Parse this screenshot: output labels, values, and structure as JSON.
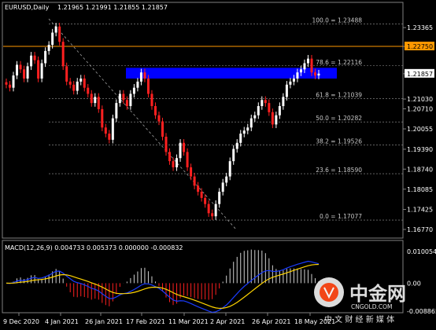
{
  "header": {
    "symbol": "EURUSD,Daily",
    "ohlc": "1.21965 1.21991 1.21855 1.21857"
  },
  "price_axis": {
    "labels": [
      "1.23365",
      "1.22750",
      "1.21857",
      "1.21030",
      "1.20710",
      "1.20055",
      "1.19390",
      "1.18740",
      "1.18085",
      "1.17425",
      "1.16770"
    ],
    "highlight_line_label": "1.22750",
    "current_price_label": "1.21857"
  },
  "date_axis": {
    "labels": [
      "9 Dec 2020",
      "4 Jan 2021",
      "26 Jan 2021",
      "17 Feb 2021",
      "11 Mar 2021",
      "2 Apr 2021",
      "26 Apr 2021",
      "18 May 2021"
    ]
  },
  "fibonacci": [
    {
      "label": "100.0 = 1.23488",
      "price": 1.23488
    },
    {
      "label": "78.6 = 1.22116",
      "price": 1.22116
    },
    {
      "label": "61.8 = 1.21039",
      "price": 1.21039
    },
    {
      "label": "50.0 = 1.20282",
      "price": 1.20282
    },
    {
      "label": "38.2 = 1.19526",
      "price": 1.19526
    },
    {
      "label": "23.6 = 1.18590",
      "price": 1.1859
    },
    {
      "label": "0.0 = 1.17077",
      "price": 1.17077
    }
  ],
  "macd": {
    "label": "MACD(12,26,9) 0.004733 0.005373 0.000000 -0.000832",
    "axis_labels": [
      "0.010054",
      "0.00",
      "-0.008865"
    ]
  },
  "watermark": {
    "logo_text": "中金网",
    "domain": "CNGOLD.COM",
    "subtitle": "中 文 财 经 新 媒 体"
  },
  "colors": {
    "background": "#000000",
    "bull": "#ffffff",
    "bear": "#ff2020",
    "highlight_line": "#ff9900",
    "zone": "#0000ff",
    "macd_line": "#1a3cff",
    "signal_line": "#ffd400",
    "grid": "#2a2a2a"
  },
  "chart_data": {
    "type": "candlestick",
    "ylim": [
      1.1677,
      1.2365
    ],
    "zone": [
      1.217,
      1.2205
    ],
    "series": [
      {
        "name": "EURUSD,Daily",
        "close": [
          1.215,
          1.214,
          1.218,
          1.2215,
          1.22,
          1.217,
          1.221,
          1.2245,
          1.223,
          1.217,
          1.222,
          1.226,
          1.228,
          1.232,
          1.234,
          1.229,
          1.221,
          1.216,
          1.215,
          1.213,
          1.216,
          1.217,
          1.214,
          1.212,
          1.209,
          1.211,
          1.207,
          1.201,
          1.199,
          1.197,
          1.204,
          1.209,
          1.212,
          1.21,
          1.208,
          1.212,
          1.214,
          1.216,
          1.219,
          1.217,
          1.212,
          1.208,
          1.205,
          1.203,
          1.198,
          1.193,
          1.19,
          1.188,
          1.191,
          1.196,
          1.193,
          1.188,
          1.185,
          1.182,
          1.18,
          1.178,
          1.176,
          1.173,
          1.172,
          1.176,
          1.18,
          1.183,
          1.185,
          1.19,
          1.194,
          1.196,
          1.199,
          1.2,
          1.201,
          1.204,
          1.205,
          1.208,
          1.21,
          1.209,
          1.206,
          1.202,
          1.205,
          1.208,
          1.211,
          1.215,
          1.216,
          1.217,
          1.219,
          1.22,
          1.222,
          1.2235,
          1.219,
          1.218,
          1.2186
        ]
      }
    ]
  }
}
